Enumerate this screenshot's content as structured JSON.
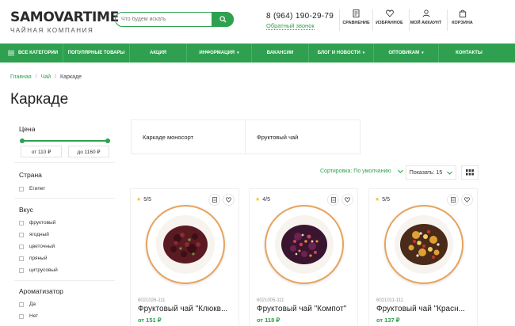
{
  "brand": {
    "name": "SAMOVARTIME",
    "tagline": "ЧАЙНАЯ КОМПАНИЯ"
  },
  "search": {
    "placeholder": "Что будем искать"
  },
  "contact": {
    "phone": "8 (964) 190-29-79",
    "callback": "Обратный звонок"
  },
  "header_icons": [
    {
      "icon": "compare-icon",
      "label": "СРАВНЕНИЕ"
    },
    {
      "icon": "heart-icon",
      "label": "ИЗБРАННОЕ"
    },
    {
      "icon": "user-icon",
      "label": "МОЙ АККАУНТ"
    },
    {
      "icon": "bag-icon",
      "label": "КОРЗИНА"
    }
  ],
  "nav": [
    {
      "label": "ВСЕ КАТЕГОРИИ"
    },
    {
      "label": "ПОПУЛЯРНЫЕ ТОВАРЫ"
    },
    {
      "label": "АКЦИЯ"
    },
    {
      "label": "ИНФОРМАЦИЯ"
    },
    {
      "label": "ВАКАНСИИ"
    },
    {
      "label": "БЛОГ И НОВОСТИ"
    },
    {
      "label": "ОПТОВИКАМ"
    },
    {
      "label": "КОНТАКТЫ"
    }
  ],
  "breadcrumb": {
    "home": "Главная",
    "section": "Чай",
    "current": "Каркаде"
  },
  "page_title": "Каркаде",
  "filters": {
    "price": {
      "title": "Цена",
      "from": "от 110 ₽",
      "to": "до 1160 ₽"
    },
    "country": {
      "title": "Страна",
      "options": [
        "Египет"
      ]
    },
    "taste": {
      "title": "Вкус",
      "options": [
        "фруктовый",
        "ягодный",
        "цветочный",
        "пряный",
        "цитрусовый"
      ]
    },
    "flavor": {
      "title": "Ароматизатор",
      "options": [
        "Да",
        "Нет"
      ]
    }
  },
  "subcategories": [
    "Каркаде моносорт",
    "Фруктовый чай"
  ],
  "sort": {
    "label": "Сортировка: По умолчанию",
    "show": "Показать: 15"
  },
  "products": [
    {
      "rating": "5/5",
      "sku": "6021026-111",
      "name": "Фруктовый чай \"Клюкв...",
      "price": "от 151 ₽",
      "tea": "red"
    },
    {
      "rating": "4/5",
      "sku": "6021005-111",
      "name": "Фруктовый чай \"Компот\"",
      "price": "от 118 ₽",
      "tea": "berry"
    },
    {
      "rating": "5/5",
      "sku": "6021011-111",
      "name": "Фруктовый чай \"Красн...",
      "price": "от 137 ₽",
      "tea": "citrus"
    }
  ],
  "colors": {
    "accent": "#2ea04f",
    "price": "#2ea04f",
    "star": "#f2c230",
    "plate_rim": "#e8a35c"
  }
}
